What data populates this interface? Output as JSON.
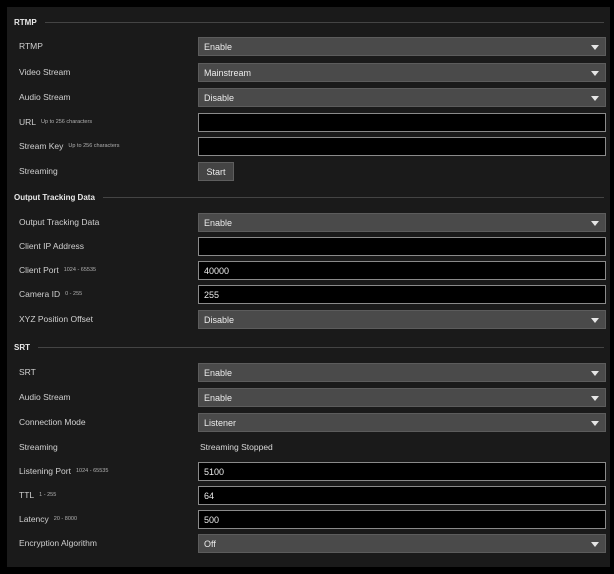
{
  "rtmp": {
    "title": "RTMP",
    "rtmp_label": "RTMP",
    "rtmp_value": "Enable",
    "video_stream_label": "Video Stream",
    "video_stream_value": "Mainstream",
    "audio_stream_label": "Audio Stream",
    "audio_stream_value": "Disable",
    "url_label": "URL",
    "url_hint": "Up to 256 characters",
    "url_value": "",
    "stream_key_label": "Stream Key",
    "stream_key_hint": "Up to 256 characters",
    "stream_key_value": "",
    "streaming_label": "Streaming",
    "start_button": "Start"
  },
  "tracking": {
    "title": "Output Tracking Data",
    "output_label": "Output Tracking Data",
    "output_value": "Enable",
    "client_ip_label": "Client IP Address",
    "client_ip_value": "",
    "client_port_label": "Client Port",
    "client_port_hint": "1024 - 65535",
    "client_port_value": "40000",
    "camera_id_label": "Camera ID",
    "camera_id_hint": "0 - 255",
    "camera_id_value": "255",
    "xyz_label": "XYZ Position Offset",
    "xyz_value": "Disable"
  },
  "srt": {
    "title": "SRT",
    "srt_label": "SRT",
    "srt_value": "Enable",
    "audio_stream_label": "Audio Stream",
    "audio_stream_value": "Enable",
    "connection_mode_label": "Connection Mode",
    "connection_mode_value": "Listener",
    "streaming_label": "Streaming",
    "streaming_status": "Streaming Stopped",
    "listening_port_label": "Listening Port",
    "listening_port_hint": "1024 - 65535",
    "listening_port_value": "5100",
    "ttl_label": "TTL",
    "ttl_hint": "1 - 255",
    "ttl_value": "64",
    "latency_label": "Latency",
    "latency_hint": "20 - 8000",
    "latency_value": "500",
    "encryption_label": "Encryption Algorithm",
    "encryption_value": "Off"
  },
  "icons": {
    "dropdown": "chevron-down-icon"
  },
  "colors": {
    "background": "#000000",
    "panel": "#1a1a1a",
    "select_bg": "#4a4a4a",
    "input_border": "#8a8a8a",
    "text": "#d4d4d4"
  }
}
